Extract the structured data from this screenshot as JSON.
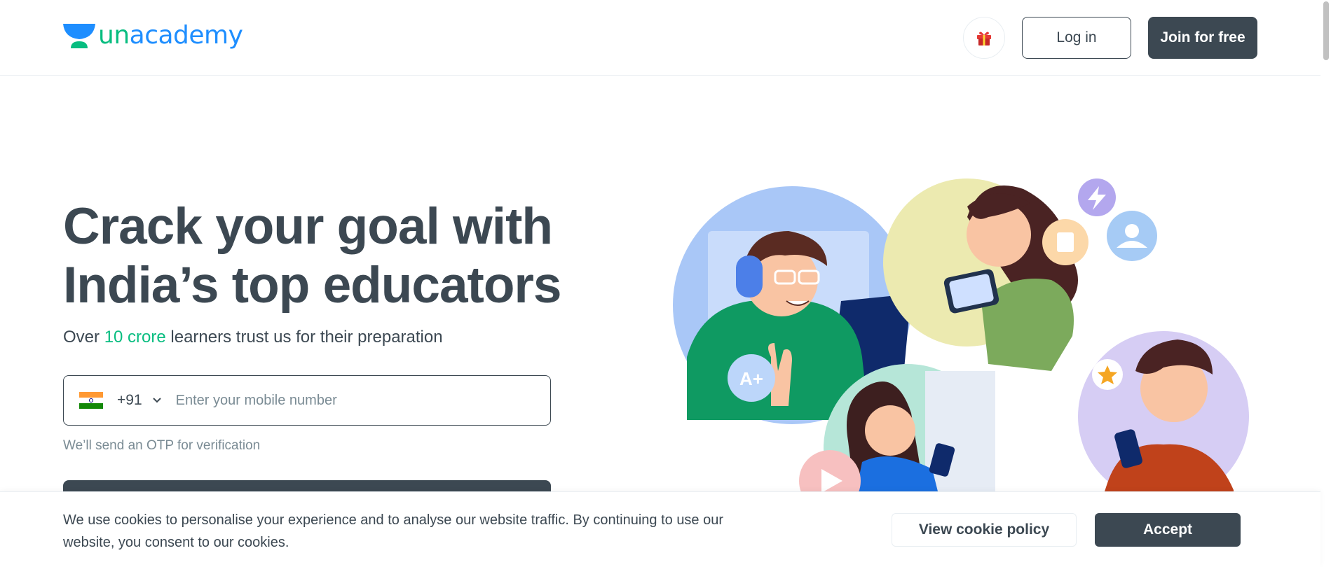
{
  "header": {
    "logo_text_part1": "un",
    "logo_text_part2": "academy",
    "login_label": "Log in",
    "join_label": "Join for free"
  },
  "hero": {
    "title_line1": "Crack your goal with",
    "title_line2": "India’s top educators",
    "subtitle_prefix": "Over ",
    "subtitle_highlight": "10 crore",
    "subtitle_suffix": " learners trust us for their preparation"
  },
  "phone": {
    "country_code": "+91",
    "placeholder": "Enter your mobile number",
    "otp_note": "We’ll send an OTP for verification"
  },
  "illustration": {
    "badge_text": "A+"
  },
  "cookie": {
    "text": "We use cookies to personalise your experience and to analyse our website traffic. By continuing to use our website, you consent to our cookies.",
    "policy_label": "View cookie policy",
    "accept_label": "Accept"
  },
  "colors": {
    "brand_green": "#08bd80",
    "brand_blue": "#1e8eff",
    "primary_dark": "#3c4852",
    "muted": "#7a8b94"
  },
  "icons": [
    "unacademy-logo-icon",
    "gift-icon",
    "india-flag-icon",
    "chevron-down-icon",
    "lightning-icon",
    "document-icon",
    "user-icon",
    "star-icon",
    "play-icon"
  ]
}
